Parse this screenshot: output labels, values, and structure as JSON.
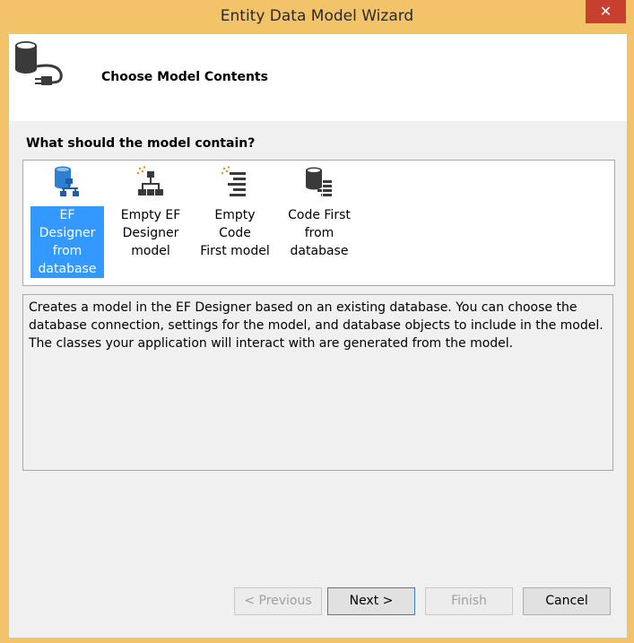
{
  "window": {
    "title": "Entity Data Model Wizard",
    "close_glyph": "✕"
  },
  "header": {
    "title": "Choose Model Contents",
    "icon": "database-plug-icon"
  },
  "question": "What should the model contain?",
  "options": [
    {
      "label_lines": [
        "EF Designer",
        "from",
        "database"
      ],
      "icon": "ef-designer-from-database-icon",
      "selected": true
    },
    {
      "label_lines": [
        "Empty EF",
        "Designer",
        "model"
      ],
      "icon": "empty-ef-designer-model-icon",
      "selected": false
    },
    {
      "label_lines": [
        "Empty Code",
        "First model"
      ],
      "icon": "empty-code-first-model-icon",
      "selected": false
    },
    {
      "label_lines": [
        "Code First",
        "from",
        "database"
      ],
      "icon": "code-first-from-database-icon",
      "selected": false
    }
  ],
  "description": "Creates a model in the EF Designer based on an existing database. You can choose the database connection, settings for the model, and database objects to include in the model. The classes your application will interact with are generated from the model.",
  "buttons": {
    "previous": {
      "label": "< Previous",
      "enabled": false
    },
    "next": {
      "label": "Next >",
      "enabled": true
    },
    "finish": {
      "label": "Finish",
      "enabled": false
    },
    "cancel": {
      "label": "Cancel",
      "enabled": true
    }
  },
  "colors": {
    "titlebar": "#f3c36a",
    "close": "#c7402f",
    "selection": "#3399ff",
    "icon_blue": "#2d7fd0",
    "icon_dark": "#3a3a3a",
    "spark": "#f08a1c"
  }
}
